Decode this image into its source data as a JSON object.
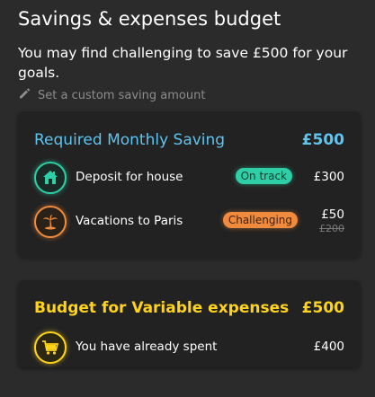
{
  "header": {
    "title": "Savings & expenses budget",
    "subtitle": "You may find challenging to save £500 for your goals.",
    "custom_link": "Set a custom saving amount"
  },
  "saving_card": {
    "title": "Required Monthly Saving",
    "amount": "£500",
    "items": [
      {
        "label": "Deposit for house",
        "status": "On track",
        "value": "£300",
        "icon": "house-icon"
      },
      {
        "label": "Vacations to Paris",
        "status": "Challenging",
        "value": "£50",
        "old_value": "£200",
        "icon": "palm-tree-icon"
      }
    ]
  },
  "variable_card": {
    "title": "Budget for Variable expenses",
    "amount": "£500",
    "items": [
      {
        "label": "You have already spent",
        "value": "£400",
        "icon": "shopping-cart-icon"
      }
    ]
  },
  "colors": {
    "background": "#2b2b2b",
    "card": "#222222",
    "blue_accent": "#5ec4f0",
    "yellow_accent": "#ffd31a",
    "green_status": "#2ecfa6",
    "orange_status": "#f08a3c"
  }
}
